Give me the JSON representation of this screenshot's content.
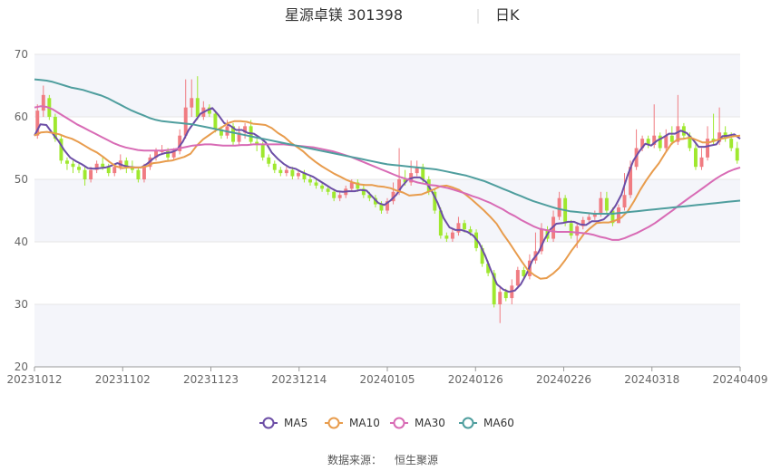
{
  "chart_data": {
    "type": "candlestick",
    "title": "星源卓镁 301398",
    "period_label": "日K",
    "source_label": "数据来源：",
    "source_name": "恒生聚源",
    "ylim": [
      20,
      70
    ],
    "y_ticks": [
      20,
      30,
      40,
      50,
      60,
      70
    ],
    "x_tick_labels": [
      "20231012",
      "20231102",
      "20231123",
      "20231214",
      "20240105",
      "20240126",
      "20240226",
      "20240318",
      "20240409"
    ],
    "grid": true,
    "legend_position": "bottom",
    "colors": {
      "up": "#f07c82",
      "down": "#9fe82e",
      "ma5": "#6c4ea6",
      "ma10": "#e89c4d",
      "ma30": "#d86bb5",
      "ma60": "#4f9e9e"
    },
    "candles": [
      [
        57.0,
        61.0,
        62.0,
        56.5
      ],
      [
        61.0,
        63.5,
        65.0,
        60.0
      ],
      [
        63.0,
        60.0,
        63.5,
        59.5
      ],
      [
        60.0,
        56.5,
        60.5,
        56.0
      ],
      [
        56.5,
        53.0,
        57.0,
        52.5
      ],
      [
        53.0,
        52.5,
        53.5,
        51.5
      ],
      [
        52.5,
        52.0,
        53.0,
        51.0
      ],
      [
        52.0,
        51.5,
        52.5,
        51.0
      ],
      [
        51.5,
        50.0,
        52.0,
        49.0
      ],
      [
        50.0,
        51.5,
        52.0,
        49.5
      ],
      [
        51.5,
        52.5,
        53.0,
        51.0
      ],
      [
        52.5,
        52.0,
        53.5,
        51.5
      ],
      [
        52.0,
        51.0,
        52.5,
        50.5
      ],
      [
        51.0,
        52.0,
        52.5,
        50.5
      ],
      [
        52.0,
        53.0,
        54.0,
        51.5
      ],
      [
        53.0,
        52.0,
        53.5,
        51.0
      ],
      [
        52.0,
        51.5,
        53.0,
        51.0
      ],
      [
        51.5,
        50.0,
        52.0,
        49.5
      ],
      [
        50.0,
        52.0,
        52.5,
        49.5
      ],
      [
        52.0,
        53.5,
        54.0,
        51.5
      ],
      [
        53.5,
        54.5,
        55.0,
        53.0
      ],
      [
        54.5,
        54.5,
        55.5,
        54.0
      ],
      [
        54.5,
        53.5,
        55.0,
        53.0
      ],
      [
        53.5,
        54.5,
        55.0,
        53.0
      ],
      [
        54.5,
        57.0,
        58.0,
        54.0
      ],
      [
        57.0,
        61.5,
        66.0,
        56.5
      ],
      [
        61.5,
        63.0,
        66.0,
        60.0
      ],
      [
        63.0,
        60.0,
        66.5,
        59.5
      ],
      [
        60.0,
        61.5,
        62.5,
        59.5
      ],
      [
        61.5,
        60.5,
        62.0,
        60.0
      ],
      [
        60.5,
        58.0,
        61.0,
        57.5
      ],
      [
        58.0,
        57.0,
        58.5,
        56.5
      ],
      [
        57.0,
        58.5,
        59.5,
        56.5
      ],
      [
        58.5,
        56.0,
        59.0,
        55.5
      ],
      [
        56.0,
        57.5,
        58.5,
        55.5
      ],
      [
        57.5,
        58.5,
        59.0,
        56.5
      ],
      [
        58.5,
        56.0,
        59.5,
        55.5
      ],
      [
        56.0,
        55.5,
        56.5,
        54.5
      ],
      [
        55.5,
        53.5,
        56.0,
        53.0
      ],
      [
        53.5,
        52.5,
        54.0,
        52.0
      ],
      [
        52.5,
        51.5,
        53.0,
        51.0
      ],
      [
        51.5,
        51.0,
        52.0,
        50.5
      ],
      [
        51.0,
        51.5,
        52.0,
        50.5
      ],
      [
        51.5,
        50.5,
        52.0,
        50.0
      ],
      [
        50.5,
        51.0,
        51.5,
        50.0
      ],
      [
        51.0,
        50.0,
        51.5,
        49.5
      ],
      [
        50.0,
        49.5,
        50.5,
        49.0
      ],
      [
        49.5,
        49.0,
        50.0,
        48.5
      ],
      [
        49.0,
        48.5,
        49.5,
        48.0
      ],
      [
        48.5,
        48.0,
        49.0,
        47.5
      ],
      [
        48.0,
        47.0,
        48.5,
        46.5
      ],
      [
        47.0,
        47.5,
        48.0,
        46.5
      ],
      [
        47.5,
        48.5,
        49.0,
        47.0
      ],
      [
        48.5,
        49.5,
        50.0,
        48.0
      ],
      [
        49.5,
        48.5,
        50.0,
        48.0
      ],
      [
        48.5,
        47.5,
        49.0,
        47.0
      ],
      [
        47.5,
        47.0,
        48.0,
        46.5
      ],
      [
        47.0,
        46.0,
        47.5,
        45.5
      ],
      [
        46.0,
        45.0,
        46.5,
        44.5
      ],
      [
        45.0,
        46.5,
        47.0,
        44.5
      ],
      [
        46.5,
        48.0,
        49.5,
        46.0
      ],
      [
        48.0,
        50.0,
        55.0,
        47.5
      ],
      [
        50.0,
        49.5,
        51.5,
        49.0
      ],
      [
        49.5,
        51.0,
        53.0,
        49.0
      ],
      [
        51.0,
        52.0,
        53.0,
        50.5
      ],
      [
        52.0,
        50.0,
        52.5,
        49.5
      ],
      [
        50.0,
        48.0,
        50.5,
        47.5
      ],
      [
        48.0,
        45.0,
        48.5,
        44.5
      ],
      [
        45.0,
        41.0,
        45.5,
        40.5
      ],
      [
        41.0,
        40.5,
        41.5,
        40.0
      ],
      [
        40.5,
        41.5,
        42.0,
        40.0
      ],
      [
        41.5,
        43.0,
        44.0,
        41.0
      ],
      [
        43.0,
        42.0,
        43.5,
        41.5
      ],
      [
        42.0,
        41.5,
        42.5,
        41.0
      ],
      [
        41.5,
        39.0,
        42.0,
        38.5
      ],
      [
        39.0,
        36.5,
        39.5,
        36.0
      ],
      [
        36.5,
        35.0,
        37.0,
        34.5
      ],
      [
        35.0,
        30.0,
        35.5,
        29.5
      ],
      [
        30.0,
        32.0,
        33.0,
        27.0
      ],
      [
        32.0,
        31.0,
        32.5,
        30.5
      ],
      [
        31.0,
        33.0,
        34.0,
        30.0
      ],
      [
        33.0,
        35.5,
        36.0,
        32.5
      ],
      [
        35.5,
        34.5,
        36.0,
        34.0
      ],
      [
        34.5,
        37.0,
        38.0,
        34.0
      ],
      [
        37.0,
        38.5,
        41.5,
        36.5
      ],
      [
        38.5,
        42.0,
        43.0,
        38.0
      ],
      [
        42.0,
        40.5,
        42.5,
        40.0
      ],
      [
        40.5,
        44.0,
        45.0,
        40.0
      ],
      [
        44.0,
        47.0,
        48.0,
        43.5
      ],
      [
        47.0,
        43.0,
        47.5,
        42.5
      ],
      [
        43.0,
        41.0,
        43.5,
        40.5
      ],
      [
        41.0,
        42.5,
        43.0,
        39.0
      ],
      [
        42.5,
        43.5,
        44.0,
        42.0
      ],
      [
        43.5,
        44.0,
        44.5,
        43.0
      ],
      [
        44.0,
        44.5,
        45.0,
        43.5
      ],
      [
        44.5,
        47.0,
        48.0,
        44.0
      ],
      [
        47.0,
        45.0,
        48.0,
        44.5
      ],
      [
        45.0,
        43.0,
        45.5,
        42.5
      ],
      [
        43.0,
        45.5,
        46.0,
        43.0
      ],
      [
        45.5,
        47.5,
        51.0,
        45.0
      ],
      [
        47.5,
        52.0,
        53.0,
        47.0
      ],
      [
        52.0,
        55.0,
        58.0,
        51.5
      ],
      [
        55.0,
        56.5,
        57.0,
        54.5
      ],
      [
        56.5,
        55.5,
        57.0,
        55.0
      ],
      [
        55.5,
        57.0,
        62.0,
        55.0
      ],
      [
        57.0,
        55.0,
        57.5,
        54.5
      ],
      [
        55.0,
        57.0,
        58.0,
        54.5
      ],
      [
        57.0,
        56.0,
        58.5,
        55.5
      ],
      [
        56.0,
        58.5,
        63.5,
        55.5
      ],
      [
        58.5,
        57.0,
        59.0,
        56.5
      ],
      [
        57.0,
        55.0,
        57.5,
        54.5
      ],
      [
        55.0,
        52.0,
        56.0,
        51.5
      ],
      [
        52.0,
        53.5,
        55.0,
        51.5
      ],
      [
        53.5,
        56.5,
        58.5,
        53.0
      ],
      [
        56.5,
        56.0,
        60.5,
        55.5
      ],
      [
        56.0,
        57.5,
        61.5,
        55.5
      ],
      [
        57.5,
        56.5,
        58.5,
        56.0
      ],
      [
        56.5,
        55.0,
        57.5,
        54.5
      ],
      [
        55.0,
        53.0,
        56.0,
        52.5
      ]
    ],
    "ma_series": [
      {
        "name": "MA5",
        "values": [
          57.0,
          58.8,
          58.7,
          57.4,
          56.2,
          54.7,
          53.5,
          52.9,
          52.4,
          51.8,
          51.7,
          51.8,
          51.9,
          52.2,
          52.6,
          52.2,
          52.0,
          51.9,
          51.9,
          52.5,
          53.3,
          53.9,
          54.2,
          54.3,
          54.7,
          56.0,
          57.9,
          59.2,
          60.5,
          61.0,
          61.4,
          60.3,
          59.0,
          58.6,
          57.9,
          57.9,
          57.4,
          57.3,
          56.7,
          55.9,
          54.3,
          53.3,
          52.5,
          51.9,
          51.7,
          51.2,
          50.8,
          50.4,
          49.8,
          49.2,
          48.6,
          48.1,
          48.0,
          48.1,
          48.1,
          48.3,
          48.2,
          47.2,
          46.2,
          45.9,
          46.6,
          47.5,
          48.9,
          50.0,
          50.3,
          50.3,
          49.6,
          48.1,
          46.2,
          43.8,
          42.3,
          41.9,
          41.9,
          41.6,
          41.0,
          39.8,
          37.8,
          35.4,
          33.2,
          32.4,
          32.0,
          32.2,
          33.2,
          34.9,
          37.1,
          38.3,
          40.4,
          42.0,
          42.9,
          43.0,
          43.2,
          43.2,
          42.8,
          42.7,
          43.3,
          43.3,
          43.6,
          44.5,
          45.8,
          47.6,
          50.6,
          53.0,
          54.5,
          55.7,
          55.4,
          56.2,
          56.7,
          57.3,
          57.3,
          57.8,
          57.4,
          56.4,
          55.2,
          55.2,
          55.4,
          55.6,
          56.9,
          57.0,
          57.2,
          56.5
        ]
      },
      {
        "name": "MA10",
        "values": [
          57.0,
          57.5,
          57.6,
          57.4,
          57.2,
          56.8,
          56.5,
          56.0,
          55.4,
          54.8,
          54.3,
          53.6,
          52.8,
          52.1,
          51.8,
          51.9,
          51.9,
          51.9,
          52.1,
          52.6,
          52.7,
          52.9,
          53.0,
          53.3,
          53.6,
          54.1,
          55.4,
          56.4,
          57.1,
          57.8,
          58.3,
          59.0,
          59.3,
          59.3,
          59.2,
          58.9,
          58.8,
          58.7,
          58.2,
          57.4,
          56.8,
          55.9,
          55.2,
          54.5,
          53.6,
          52.8,
          52.1,
          51.5,
          50.9,
          50.4,
          49.9,
          49.5,
          49.2,
          49.1,
          49.1,
          48.9,
          48.8,
          48.6,
          48.2,
          47.9,
          47.4,
          47.5,
          47.6,
          48.0,
          48.4,
          48.9,
          49.0,
          48.7,
          48.3,
          47.6,
          46.8,
          45.9,
          45.0,
          44.0,
          42.9,
          41.3,
          39.9,
          38.4,
          36.9,
          35.5,
          34.7,
          34.1,
          34.2,
          34.9,
          35.8,
          37.1,
          38.6,
          39.9,
          41.3,
          42.2,
          43.0,
          43.1,
          43.1,
          43.4,
          43.9,
          44.9,
          46.5,
          48.3,
          49.9,
          51.3,
          52.6,
          54.2,
          55.7,
          56.4,
          56.5,
          56.7,
          56.3,
          55.9,
          55.9,
          56.2,
          56.5,
          56.7,
          56.9,
          57.0
        ]
      },
      {
        "name": "MA30",
        "values": [
          61.5,
          61.7,
          61.6,
          61.2,
          60.6,
          60.0,
          59.4,
          58.8,
          58.3,
          57.8,
          57.3,
          56.8,
          56.3,
          55.8,
          55.4,
          55.1,
          54.9,
          54.7,
          54.6,
          54.6,
          54.6,
          54.6,
          54.7,
          54.8,
          55.0,
          55.2,
          55.4,
          55.5,
          55.6,
          55.6,
          55.5,
          55.4,
          55.4,
          55.4,
          55.5,
          55.5,
          55.6,
          55.6,
          55.6,
          55.6,
          55.6,
          55.6,
          55.5,
          55.4,
          55.3,
          55.2,
          55.1,
          54.9,
          54.7,
          54.5,
          54.2,
          53.9,
          53.6,
          53.2,
          52.8,
          52.4,
          52.0,
          51.6,
          51.2,
          50.8,
          50.4,
          50.1,
          49.8,
          49.5,
          49.3,
          49.1,
          49.0,
          48.8,
          48.6,
          48.3,
          48.0,
          47.7,
          47.3,
          47.0,
          46.6,
          46.2,
          45.7,
          45.2,
          44.6,
          44.1,
          43.5,
          43.0,
          42.5,
          42.1,
          41.9,
          41.7,
          41.6,
          41.6,
          41.6,
          41.5,
          41.4,
          41.3,
          41.1,
          40.8,
          40.6,
          40.3,
          40.3,
          40.6,
          41.0,
          41.4,
          41.9,
          42.4,
          43.0,
          43.7,
          44.4,
          45.1,
          45.9,
          46.6,
          47.3,
          48.0,
          48.7,
          49.4,
          50.1,
          50.7,
          51.2,
          51.6,
          51.9
        ]
      },
      {
        "name": "MA60",
        "values": [
          66.0,
          65.9,
          65.8,
          65.6,
          65.3,
          65.0,
          64.7,
          64.5,
          64.3,
          64.0,
          63.7,
          63.4,
          63.0,
          62.5,
          62.0,
          61.5,
          61.0,
          60.6,
          60.2,
          59.8,
          59.5,
          59.3,
          59.2,
          59.1,
          59.0,
          58.9,
          58.8,
          58.6,
          58.4,
          58.2,
          58.0,
          57.8,
          57.6,
          57.4,
          57.2,
          57.0,
          56.8,
          56.6,
          56.4,
          56.2,
          56.0,
          55.8,
          55.6,
          55.4,
          55.2,
          55.0,
          54.8,
          54.6,
          54.4,
          54.2,
          54.0,
          53.8,
          53.6,
          53.4,
          53.2,
          53.0,
          52.8,
          52.6,
          52.4,
          52.3,
          52.2,
          52.1,
          52.0,
          51.9,
          51.8,
          51.7,
          51.6,
          51.4,
          51.2,
          51.0,
          50.8,
          50.6,
          50.3,
          50.0,
          49.7,
          49.3,
          48.9,
          48.5,
          48.1,
          47.7,
          47.3,
          46.9,
          46.5,
          46.2,
          45.9,
          45.6,
          45.3,
          45.1,
          44.9,
          44.8,
          44.7,
          44.6,
          44.5,
          44.5,
          44.5,
          44.5,
          44.6,
          44.7,
          44.8,
          44.9,
          45.0,
          45.1,
          45.2,
          45.3,
          45.4,
          45.5,
          45.6,
          45.7,
          45.8,
          45.9,
          46.0,
          46.1,
          46.2,
          46.3,
          46.4,
          46.5,
          46.6
        ]
      }
    ]
  }
}
